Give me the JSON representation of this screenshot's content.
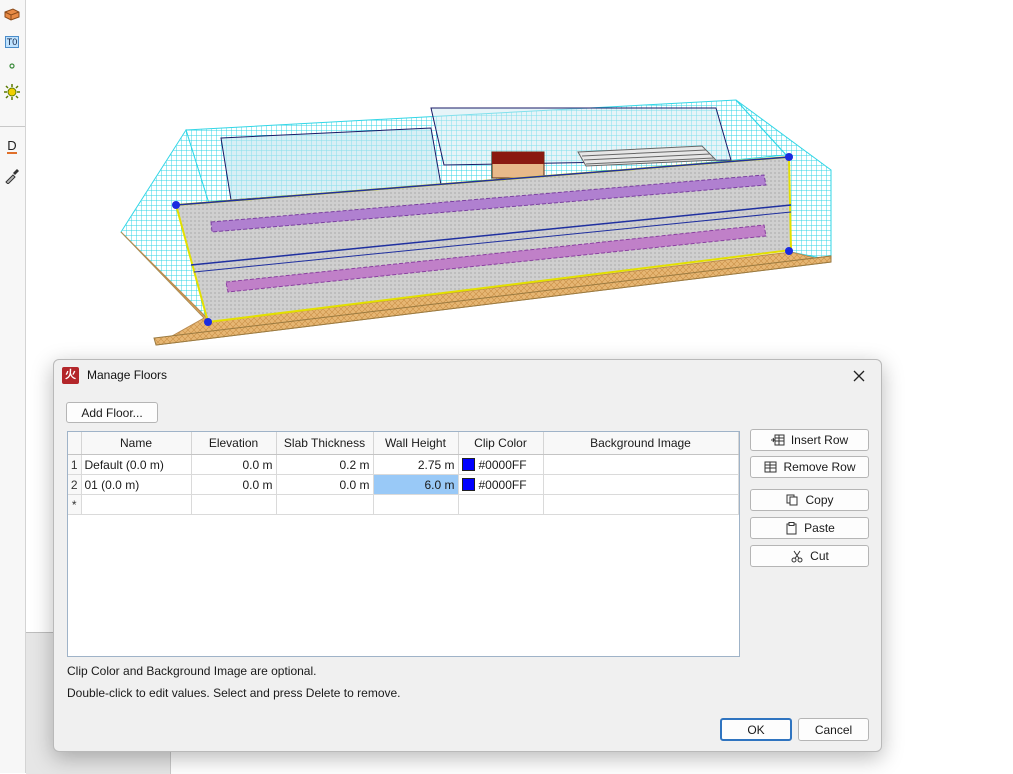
{
  "dialog": {
    "title": "Manage Floors",
    "app_icon_char": "火",
    "add_floor_label": "Add Floor...",
    "columns": [
      "Name",
      "Elevation",
      "Slab Thickness",
      "Wall Height",
      "Clip Color",
      "Background Image"
    ],
    "rows": [
      {
        "num": "1",
        "name": "Default (0.0 m)",
        "elevation": "0.0 m",
        "slab": "0.2 m",
        "wall": "2.75 m",
        "clip": "#0000FF",
        "bg": ""
      },
      {
        "num": "2",
        "name": "01 (0.0 m)",
        "elevation": "0.0 m",
        "slab": "0.0 m",
        "wall": "6.0 m",
        "clip": "#0000FF",
        "bg": ""
      }
    ],
    "new_row_marker": "*",
    "side_buttons": {
      "insert_row": "Insert Row",
      "remove_row": "Remove Row",
      "copy": "Copy",
      "paste": "Paste",
      "cut": "Cut"
    },
    "hint1": "Clip Color and Background Image are optional.",
    "hint2": "Double-click to edit values. Select and press Delete to remove.",
    "ok_label": "OK",
    "cancel_label": "Cancel"
  },
  "toolbar": {
    "tools": [
      "brick-icon",
      "text-t0-icon",
      "point-icon",
      "sun-icon",
      "dimension-d-icon",
      "eyedropper-icon"
    ],
    "t0_label": "T0",
    "d_label": "D"
  },
  "colors": {
    "clip_color": "#0000FF",
    "selected_cell": "#99c9f7",
    "accent": "#2f74c0",
    "mesh": "#33d6e6",
    "slab": "#cccccc",
    "floor": "#e6b673"
  }
}
